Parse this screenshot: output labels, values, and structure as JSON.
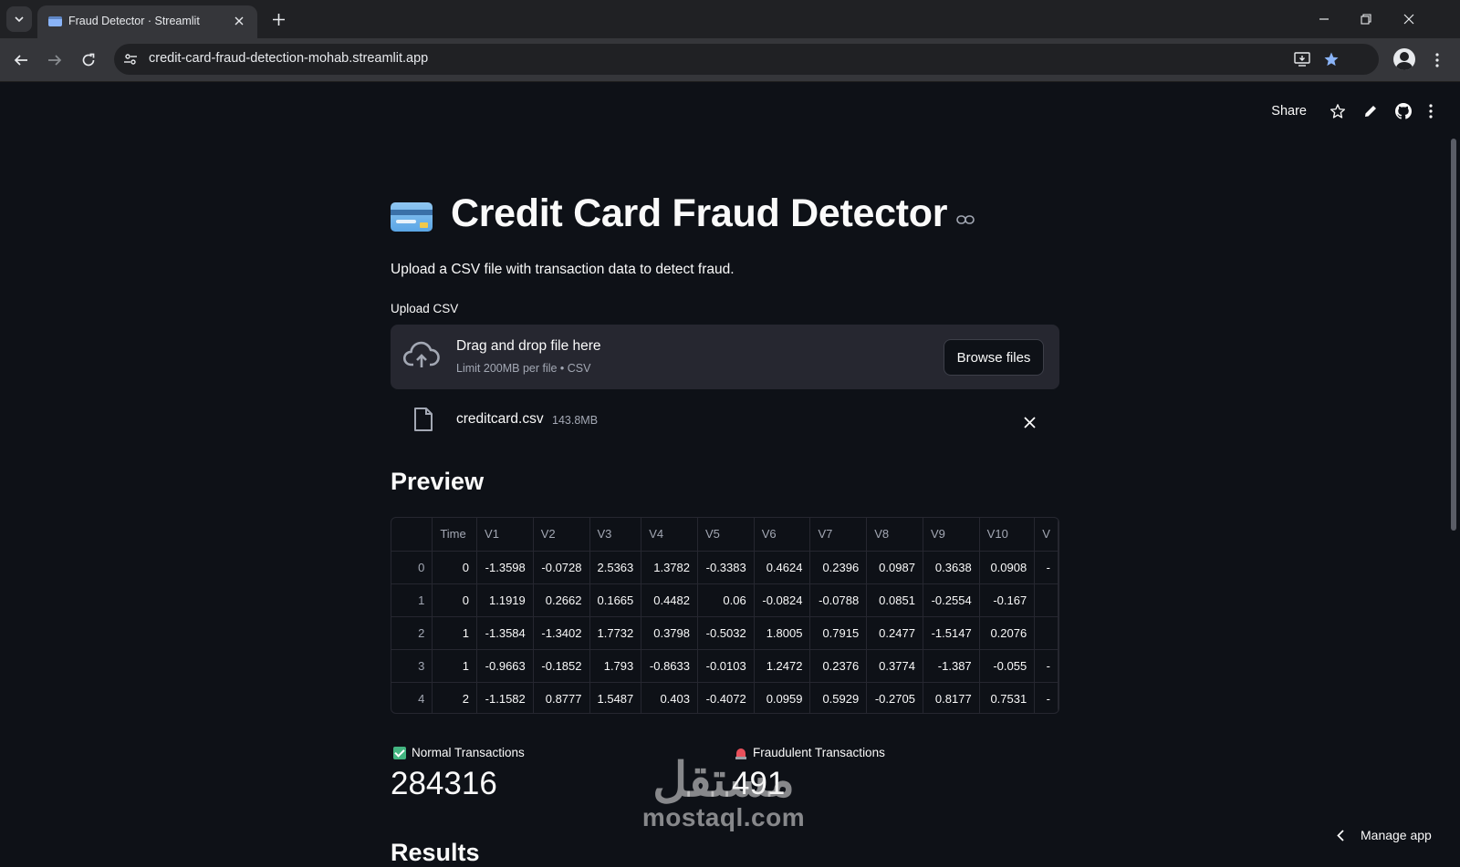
{
  "browser": {
    "tab_title": "Fraud Detector · Streamlit",
    "url": "credit-card-fraud-detection-mohab.streamlit.app"
  },
  "app_header": {
    "share_label": "Share"
  },
  "page": {
    "title": "Credit Card Fraud Detector",
    "subtitle": "Upload a CSV file with transaction data to detect fraud."
  },
  "uploader": {
    "label": "Upload CSV",
    "drop_title": "Drag and drop file here",
    "drop_subtitle": "Limit 200MB per file • CSV",
    "browse_label": "Browse files",
    "file_name": "creditcard.csv",
    "file_size": "143.8MB"
  },
  "preview": {
    "heading": "Preview",
    "columns": [
      "",
      "Time",
      "V1",
      "V2",
      "V3",
      "V4",
      "V5",
      "V6",
      "V7",
      "V8",
      "V9",
      "V10",
      "V"
    ],
    "rows": [
      [
        "0",
        "0",
        "-1.3598",
        "-0.0728",
        "2.5363",
        "1.3782",
        "-0.3383",
        "0.4624",
        "0.2396",
        "0.0987",
        "0.3638",
        "0.0908",
        "-"
      ],
      [
        "1",
        "0",
        "1.1919",
        "0.2662",
        "0.1665",
        "0.4482",
        "0.06",
        "-0.0824",
        "-0.0788",
        "0.0851",
        "-0.2554",
        "-0.167",
        ""
      ],
      [
        "2",
        "1",
        "-1.3584",
        "-1.3402",
        "1.7732",
        "0.3798",
        "-0.5032",
        "1.8005",
        "0.7915",
        "0.2477",
        "-1.5147",
        "0.2076",
        ""
      ],
      [
        "3",
        "1",
        "-0.9663",
        "-0.1852",
        "1.793",
        "-0.8633",
        "-0.0103",
        "1.2472",
        "0.2376",
        "0.3774",
        "-1.387",
        "-0.055",
        "-"
      ],
      [
        "4",
        "2",
        "-1.1582",
        "0.8777",
        "1.5487",
        "0.403",
        "-0.4072",
        "0.0959",
        "0.5929",
        "-0.2705",
        "0.8177",
        "0.7531",
        "-"
      ]
    ]
  },
  "metrics": {
    "normal_label": "Normal Transactions",
    "normal_value": "284316",
    "fraud_label": "Fraudulent Transactions",
    "fraud_value": "491"
  },
  "results": {
    "heading": "Results"
  },
  "watermark": {
    "arabic": "مستقل",
    "latin": "mostaql.com"
  },
  "footer": {
    "manage_app_label": "Manage app"
  },
  "colors": {
    "background": "#0e1117",
    "secondary_background": "#262730",
    "text": "#fafafa",
    "muted_text": "#a3a8b4"
  }
}
